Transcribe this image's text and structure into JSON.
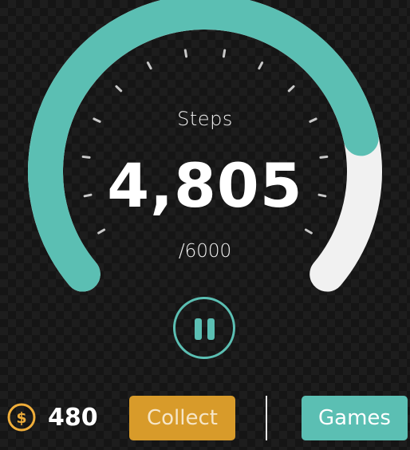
{
  "steps": {
    "label": "Steps",
    "count": "4,805",
    "goal": "/6000",
    "progress_fraction": 0.8
  },
  "coins": {
    "count": "480"
  },
  "buttons": {
    "collect_label": "Collect",
    "games_label": "Games"
  },
  "icons": {
    "pause": "pause-icon",
    "coin": "dollar-coin-icon"
  },
  "colors": {
    "accent": "#5bbfb3",
    "track": "#f1f1f1",
    "collect": "#d89b2a",
    "tick": "#c8c8c8",
    "coin": "#f0ae3a"
  }
}
